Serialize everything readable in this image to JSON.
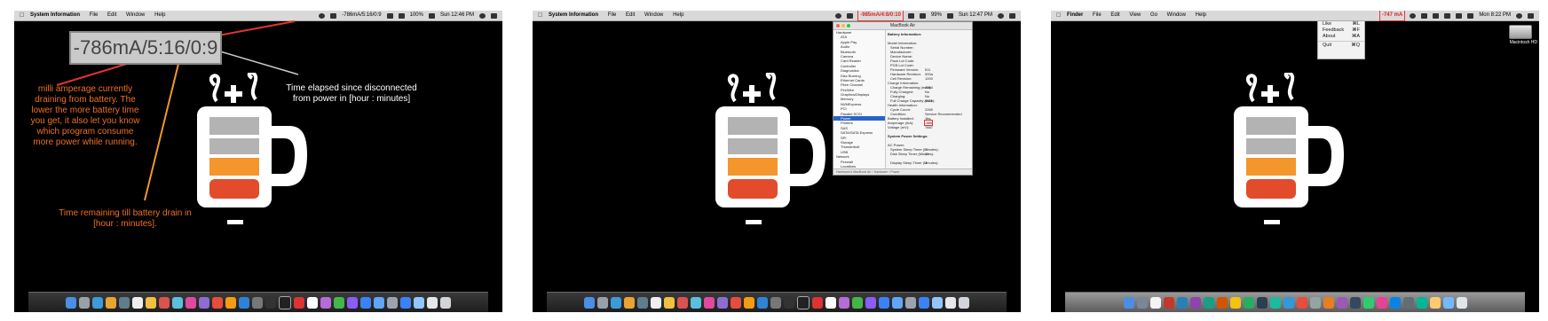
{
  "panel1": {
    "menubar": {
      "app_name": "System Information",
      "menus": [
        "File",
        "Edit",
        "Window",
        "Help"
      ],
      "status_readout": "-786mA/5:16/0:9",
      "battery": "100%",
      "clock": "Sun 12:46 PM"
    },
    "callout_readout": "-786mA/5:16/0:9",
    "note_amperage": "milli amperage currently draining from battery. The lower the more battery time you get, it also let you know which program consume more power while running.",
    "note_elapsed": "Time elapsed since disconnected from power in [hour : minutes]",
    "note_remaining": "Time remaining till battery drain in [hour : minutes]."
  },
  "panel2": {
    "menubar": {
      "app_name": "System Information",
      "menus": [
        "File",
        "Edit",
        "Window",
        "Help"
      ],
      "status_readout": "-985mA/4:8/0:10",
      "battery": "99%",
      "clock": "Sun 12:47 PM"
    },
    "window": {
      "title": "MacBook Air",
      "sidebar": [
        {
          "label": "Hardware",
          "hdr": true
        },
        {
          "label": "ATA"
        },
        {
          "label": "Apple Pay"
        },
        {
          "label": "Audio"
        },
        {
          "label": "Bluetooth"
        },
        {
          "label": "Camera"
        },
        {
          "label": "Card Reader"
        },
        {
          "label": "Controller"
        },
        {
          "label": "Diagnostics"
        },
        {
          "label": "Disc Burning"
        },
        {
          "label": "Ethernet Cards"
        },
        {
          "label": "Fibre Channel"
        },
        {
          "label": "FireWire"
        },
        {
          "label": "Graphics/Displays"
        },
        {
          "label": "Memory"
        },
        {
          "label": "NVMExpress"
        },
        {
          "label": "PCI"
        },
        {
          "label": "Parallel SCSI"
        },
        {
          "label": "Power",
          "sel": true
        },
        {
          "label": "Printers"
        },
        {
          "label": "SAS"
        },
        {
          "label": "SATA/SATA Express"
        },
        {
          "label": "SPI"
        },
        {
          "label": "Storage"
        },
        {
          "label": "Thunderbolt"
        },
        {
          "label": "USB"
        },
        {
          "label": "Network",
          "hdr": true
        },
        {
          "label": "Firewall"
        },
        {
          "label": "Locations"
        },
        {
          "label": "Volumes"
        }
      ],
      "main": [
        {
          "label": "Battery Information:",
          "b": true
        },
        {
          "label": ""
        },
        {
          "label": "Model Information:"
        },
        {
          "label": "Serial Number:",
          "ind": true
        },
        {
          "label": "Manufacturer:",
          "ind": true
        },
        {
          "label": "Device Name:",
          "ind": true
        },
        {
          "label": "Pack Lot Code:",
          "ind": true
        },
        {
          "label": "PCB Lot Code:",
          "ind": true
        },
        {
          "label": "Firmware Version:",
          "ind": true,
          "v": "511"
        },
        {
          "label": "Hardware Revision:",
          "ind": true,
          "v": "000a"
        },
        {
          "label": "Cell Revision:",
          "ind": true,
          "v": "1200"
        },
        {
          "label": "Charge Information:"
        },
        {
          "label": "Charge Remaining (mAh):",
          "ind": true,
          "v": "4084"
        },
        {
          "label": "Fully Charged:",
          "ind": true,
          "v": "No"
        },
        {
          "label": "Charging:",
          "ind": true,
          "v": "No"
        },
        {
          "label": "Full Charge Capacity (mAh):",
          "ind": true,
          "v": "4321"
        },
        {
          "label": "Health Information:"
        },
        {
          "label": "Cycle Count:",
          "ind": true,
          "v": "2269"
        },
        {
          "label": "Condition:",
          "ind": true,
          "v": "Service Recommended"
        },
        {
          "label": "Battery Installed:",
          "v": "Yes"
        },
        {
          "label": "Amperage (mA):",
          "v": "-985",
          "hl": true
        },
        {
          "label": "Voltage (mV):",
          "v": "7887"
        },
        {
          "label": ""
        },
        {
          "label": "System Power Settings:",
          "b": true
        },
        {
          "label": ""
        },
        {
          "label": "AC Power:"
        },
        {
          "label": "System Sleep Timer (Minutes):",
          "ind": true,
          "v": "1"
        },
        {
          "label": "Disk Sleep Timer (Minutes):",
          "ind": true,
          "v": "10"
        },
        {
          "label": ""
        },
        {
          "label": "Display Sleep Timer (Minutes):",
          "ind": true,
          "v": "1"
        },
        {
          "label": ""
        },
        {
          "label": "Wake on AC Change:",
          "ind": true,
          "v": "No"
        }
      ],
      "footer": "Hartmann's MacBook Air › Hardware › Power"
    }
  },
  "panel3": {
    "menubar": {
      "app_name": "Finder",
      "menus": [
        "File",
        "Edit",
        "View",
        "Go",
        "Window",
        "Help"
      ],
      "status_readout": "-747 mA",
      "clock": "Mon 8:22 PM"
    },
    "dropdown": [
      {
        "label": "Like",
        "key": "⌘L"
      },
      {
        "label": "Feedback",
        "key": "⌘F"
      },
      {
        "label": "About",
        "key": "⌘A"
      },
      {
        "label": "Quit",
        "key": "⌘Q",
        "sep": true
      }
    ],
    "disk_label": "Macintosh HD"
  },
  "colors": {
    "annotation_orange": "#f07024",
    "annotation_red": "#e33333",
    "cup_gray": "#b3b3b3",
    "cup_orange": "#f3962c",
    "cup_red": "#e24b2b"
  }
}
